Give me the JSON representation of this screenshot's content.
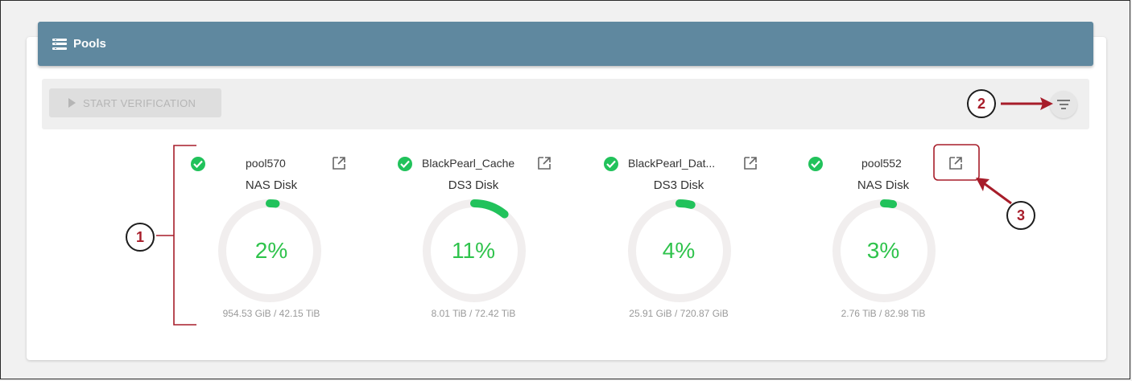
{
  "header": {
    "title": "Pools",
    "icon": "list-icon"
  },
  "toolbar": {
    "start_label": "START VERIFICATION",
    "filter_icon": "filter-icon"
  },
  "pools": [
    {
      "name": "pool570",
      "type": "NAS Disk",
      "percent_label": "2%",
      "percent": 0.02,
      "capacity": "954.53 GiB / 42.15 TiB"
    },
    {
      "name": "BlackPearl_Cache",
      "type": "DS3 Disk",
      "percent_label": "11%",
      "percent": 0.11,
      "capacity": "8.01 TiB / 72.42 TiB"
    },
    {
      "name": "BlackPearl_Dat...",
      "type": "DS3 Disk",
      "percent_label": "4%",
      "percent": 0.04,
      "capacity": "25.91 GiB / 720.87 GiB"
    },
    {
      "name": "pool552",
      "type": "NAS Disk",
      "percent_label": "3%",
      "percent": 0.03,
      "capacity": "2.76 TiB / 82.98 TiB"
    }
  ],
  "annotations": {
    "a1": "1",
    "a2": "2",
    "a3": "3"
  },
  "colors": {
    "header": "#5f889f",
    "status_ok": "#21c25b",
    "gauge": "#2fc34c",
    "annotation": "#a71d2a"
  }
}
